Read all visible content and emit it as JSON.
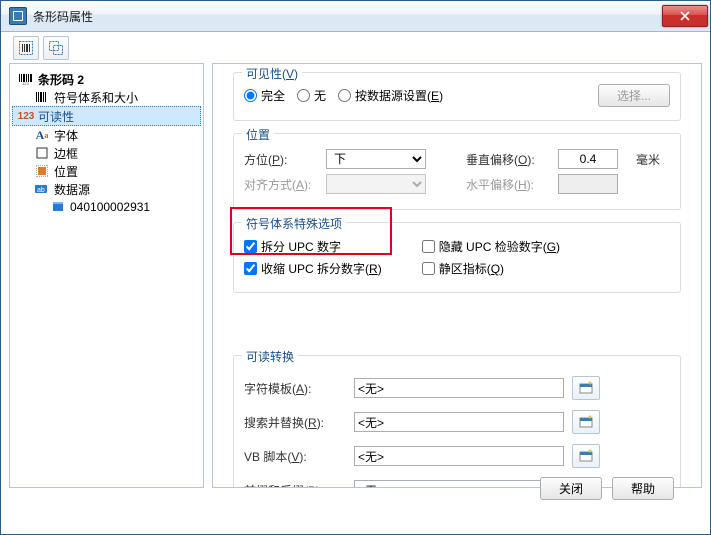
{
  "window": {
    "title": "条形码属性"
  },
  "tree": {
    "root": "条形码 2",
    "items": [
      {
        "label": "符号体系和大小"
      },
      {
        "label": "可读性",
        "selected": true
      },
      {
        "label": "字体"
      },
      {
        "label": "边框"
      },
      {
        "label": "位置"
      },
      {
        "label": "数据源",
        "children": [
          {
            "label": "040100002931"
          }
        ]
      }
    ]
  },
  "visibility": {
    "legend": "可见性",
    "accel": "V",
    "options": {
      "full": "完全",
      "none": "无",
      "source_prefix": "按数据源设置",
      "source_accel": "E"
    },
    "selected": "full",
    "select_btn": "选择..."
  },
  "position": {
    "legend": "位置",
    "orientation_label": "方位",
    "orientation_accel": "P",
    "orientation_value": "下",
    "align_label": "对齐方式",
    "align_accel": "A",
    "v_offset_label": "垂直偏移",
    "v_offset_accel": "O",
    "v_offset_value": "0.4",
    "v_offset_unit": "毫米",
    "h_offset_label": "水平偏移",
    "h_offset_accel": "H"
  },
  "special": {
    "legend": "符号体系特殊选项",
    "split": {
      "label": "拆分 UPC 数字",
      "checked": true
    },
    "shrink": {
      "label_prefix": "收缩 UPC 拆分数字",
      "accel": "R",
      "checked": true
    },
    "hide_check": {
      "label_prefix": "隐藏 UPC 检验数字",
      "accel": "G",
      "checked": false
    },
    "quiet": {
      "label_prefix": "静区指标",
      "accel": "Q",
      "checked": false
    }
  },
  "convert": {
    "legend": "可读转换",
    "rows": [
      {
        "label_prefix": "字符模板",
        "accel": "A",
        "value": "<无>"
      },
      {
        "label_prefix": "搜索并替换",
        "accel": "R",
        "value": "<无>"
      },
      {
        "label_prefix": "VB 脚本",
        "accel": "V",
        "value": "<无>"
      },
      {
        "label_prefix": "前缀和后缀",
        "accel": "P",
        "value": "<无>"
      }
    ]
  },
  "footer": {
    "close": "关闭",
    "help": "帮助"
  },
  "colors": {
    "highlight": "#e4001d"
  }
}
